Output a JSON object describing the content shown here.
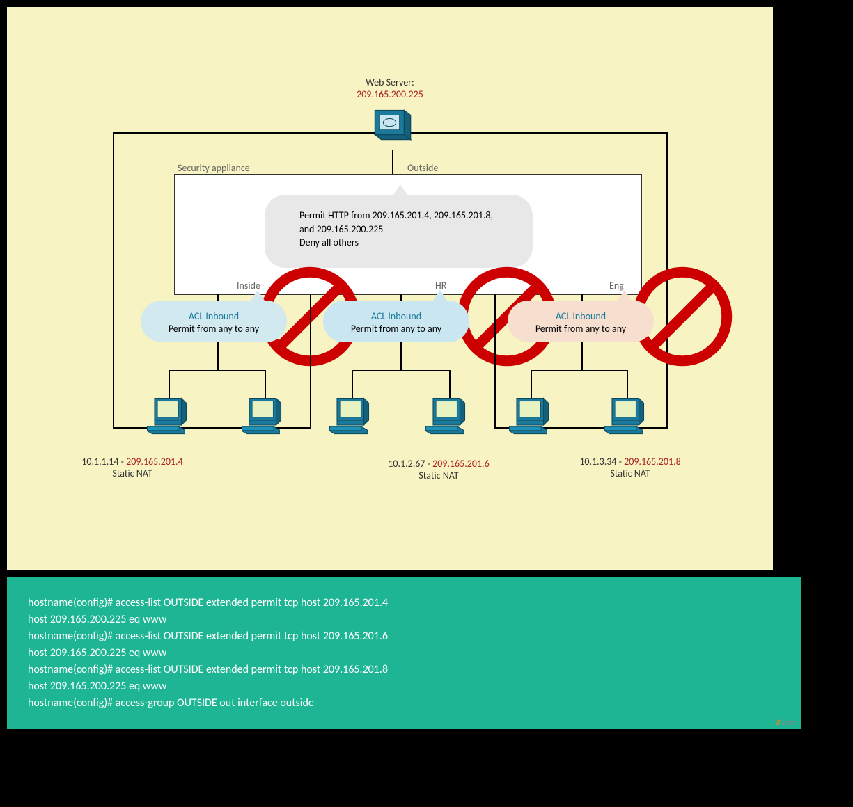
{
  "web_server": {
    "title": "Web Server:",
    "ip": "209.165.200.225"
  },
  "appliance": {
    "security_label": "Security appliance",
    "outside_label": "Outside",
    "inside_label": "Inside",
    "hr_label": "HR",
    "eng_label": "Eng"
  },
  "permit_box": {
    "prefix": "Permit HTTP from ",
    "ip1": "209.165.201.4,",
    "ip2": "209.165.201.8,",
    "mid": " and ",
    "ip3": "209.165.200.225",
    "deny": "Deny all others"
  },
  "acl": {
    "title": "ACL Inbound",
    "permit_from": "Permit from ",
    "any1": "any",
    "to": " to ",
    "any2": "any"
  },
  "hosts": {
    "h1_ip": "10.1.1.14",
    "h1_nat": "209.165.201.4",
    "h2_ip": "10.1.2.67",
    "h2_nat": "209.165.201.6",
    "h3_ip": "10.1.3.34",
    "h3_nat": "209.165.201.8",
    "sep": " - ",
    "static_nat": "Static NAT"
  },
  "config": {
    "line1": "hostname(config)# access-list OUTSIDE extended permit tcp host 209.165.201.4",
    "line2": "host 209.165.200.225 eq www",
    "line3": "hostname(config)# access-list OUTSIDE extended permit tcp host 209.165.201.6",
    "line4": "host 209.165.200.225 eq www",
    "line5": "hostname(config)# access-list OUTSIDE extended permit tcp host 209.165.201.8",
    "line6": "host 209.165.200.225 eq www",
    "line7": "hostname(config)# access-group OUTSIDE out interface outside"
  },
  "watermark": ".com"
}
